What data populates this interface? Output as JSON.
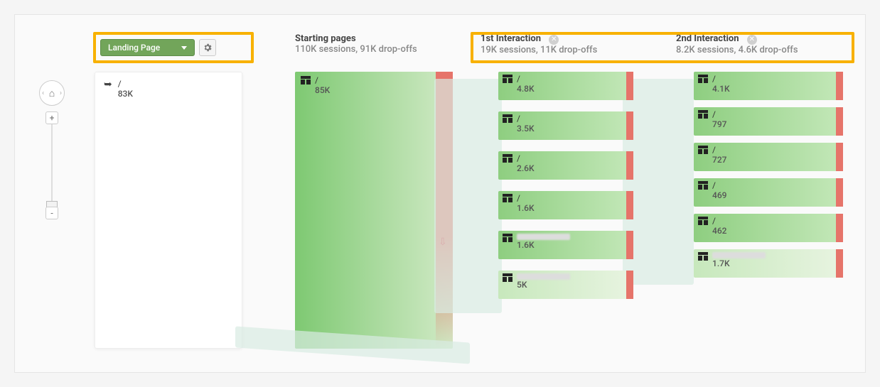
{
  "dimension": {
    "label": "Landing Page"
  },
  "columns": {
    "start": {
      "title": "Starting pages",
      "sub": "110K sessions, 91K drop-offs"
    },
    "first": {
      "title": "1st Interaction",
      "sub": "19K sessions, 11K drop-offs"
    },
    "second": {
      "title": "2nd Interaction",
      "sub": "8.2K sessions, 4.6K drop-offs"
    }
  },
  "landing": {
    "path": "/",
    "value": "83K"
  },
  "startNode": {
    "path": "/",
    "value": "85K"
  },
  "first_nodes": [
    {
      "path": "/",
      "value": "4.8K"
    },
    {
      "path": "/",
      "value": "3.5K"
    },
    {
      "path": "/",
      "value": "2.6K"
    },
    {
      "path": "/",
      "value": "1.6K"
    },
    {
      "path": "",
      "value": "1.6K"
    },
    {
      "path": "",
      "value": "5K",
      "more": true
    }
  ],
  "second_nodes": [
    {
      "path": "/",
      "value": "4.1K"
    },
    {
      "path": "/",
      "value": "797"
    },
    {
      "path": "/",
      "value": "727"
    },
    {
      "path": "/",
      "value": "469"
    },
    {
      "path": "/",
      "value": "462"
    },
    {
      "path": "",
      "value": "1.7K",
      "more": true
    }
  ],
  "chart_data": {
    "type": "sankey",
    "title": "Behavior Flow",
    "dimension": "Landing Page",
    "columns": [
      "Landing Page",
      "Starting pages",
      "1st Interaction",
      "2nd Interaction"
    ],
    "stages": [
      {
        "name": "Landing Page",
        "sessions": 83000
      },
      {
        "name": "Starting pages",
        "sessions": 110000,
        "dropoffs": 91000
      },
      {
        "name": "1st Interaction",
        "sessions": 19000,
        "dropoffs": 11000
      },
      {
        "name": "2nd Interaction",
        "sessions": 8200,
        "dropoffs": 4600
      }
    ],
    "nodes": {
      "landing": [
        {
          "page": "/",
          "sessions": 83000
        }
      ],
      "starting": [
        {
          "page": "/",
          "sessions": 85000
        }
      ],
      "first": [
        {
          "page": "/",
          "sessions": 4800
        },
        {
          "page": "/",
          "sessions": 3500
        },
        {
          "page": "/",
          "sessions": 2600
        },
        {
          "page": "/",
          "sessions": 1600
        },
        {
          "page": "(redacted)",
          "sessions": 1600
        },
        {
          "page": "(more pages)",
          "sessions": 5000
        }
      ],
      "second": [
        {
          "page": "/",
          "sessions": 4100
        },
        {
          "page": "/",
          "sessions": 797
        },
        {
          "page": "/",
          "sessions": 727
        },
        {
          "page": "/",
          "sessions": 469
        },
        {
          "page": "/",
          "sessions": 462
        },
        {
          "page": "(more pages)",
          "sessions": 1700
        }
      ]
    }
  }
}
